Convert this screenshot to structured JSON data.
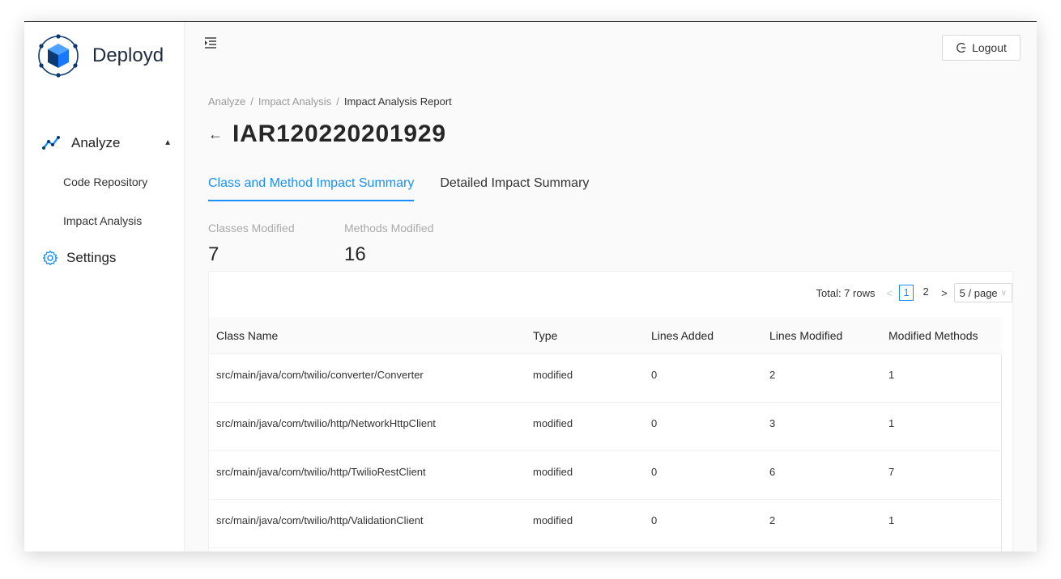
{
  "app": {
    "name": "Deployd"
  },
  "sidebar": {
    "analyze": {
      "label": "Analyze",
      "expanded": true,
      "icon": "analyze-line-icon"
    },
    "sub_items": [
      "Code Repository",
      "Impact Analysis"
    ],
    "settings": {
      "label": "Settings",
      "icon": "gear-icon"
    }
  },
  "header": {
    "logout_label": "Logout",
    "logout_icon": "logout-icon",
    "menu_icon": "menu-fold-icon"
  },
  "breadcrumb": {
    "items": [
      "Analyze",
      "Impact Analysis",
      "Impact Analysis Report"
    ]
  },
  "page": {
    "title": "IAR120220201929"
  },
  "tabs": [
    {
      "label": "Class and Method Impact Summary",
      "active": true
    },
    {
      "label": "Detailed Impact Summary",
      "active": false
    }
  ],
  "stats": {
    "classes": {
      "label": "Classes Modified",
      "value": "7"
    },
    "methods": {
      "label": "Methods Modified",
      "value": "16"
    }
  },
  "pagination": {
    "total": "Total: 7 rows",
    "pages": [
      "1",
      "2"
    ],
    "current": "1",
    "page_size": "5 / page"
  },
  "table": {
    "columns": [
      "Class Name",
      "Type",
      "Lines Added",
      "Lines Modified",
      "Modified Methods"
    ],
    "rows": [
      [
        "src/main/java/com/twilio/converter/Converter",
        "modified",
        "0",
        "2",
        "1"
      ],
      [
        "src/main/java/com/twilio/http/NetworkHttpClient",
        "modified",
        "0",
        "3",
        "1"
      ],
      [
        "src/main/java/com/twilio/http/TwilioRestClient",
        "modified",
        "0",
        "6",
        "7"
      ],
      [
        "src/main/java/com/twilio/http/ValidationClient",
        "modified",
        "0",
        "2",
        "1"
      ]
    ]
  },
  "colors": {
    "accent": "#1890ff",
    "logo_blue": "#1677ff",
    "logo_navy": "#0b3a73"
  }
}
